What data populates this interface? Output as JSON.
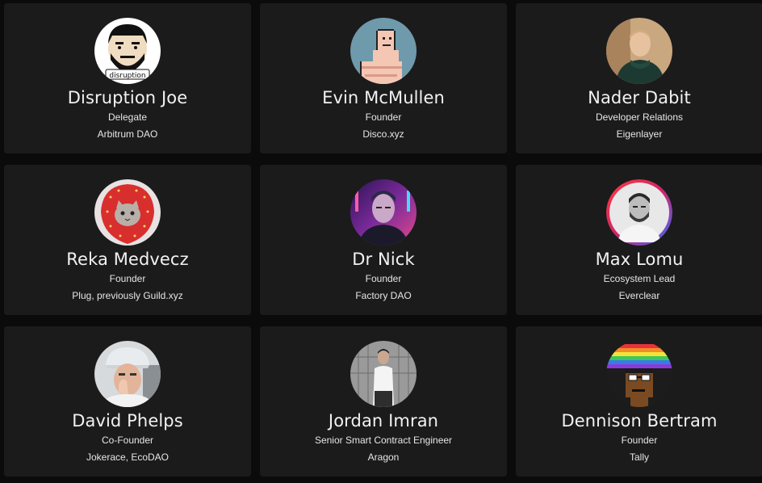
{
  "speakers": [
    {
      "name": "Disruption Joe",
      "role": "Delegate",
      "org": "Arbitrum DAO",
      "avatar_icon": "cartoon-man-avatar-icon"
    },
    {
      "name": "Evin McMullen",
      "role": "Founder",
      "org": "Disco.xyz",
      "avatar_icon": "pixel-character-avatar-icon"
    },
    {
      "name": "Nader Dabit",
      "role": "Developer Relations",
      "org": "Eigenlayer",
      "avatar_icon": "person-photo-avatar-icon"
    },
    {
      "name": "Reka Medvecz",
      "role": "Founder",
      "org": "Plug, previously Guild.xyz",
      "avatar_icon": "strawberry-cat-avatar-icon"
    },
    {
      "name": "Dr Nick",
      "role": "Founder",
      "org": "Factory DAO",
      "avatar_icon": "neon-portrait-avatar-icon"
    },
    {
      "name": "Max Lomu",
      "role": "Ecosystem Lead",
      "org": "Everclear",
      "avatar_icon": "bw-portrait-avatar-icon"
    },
    {
      "name": "David Phelps",
      "role": "Co-Founder",
      "org": "Jokerace, EcoDAO",
      "avatar_icon": "selfie-avatar-icon"
    },
    {
      "name": "Jordan Imran",
      "role": "Senior Smart Contract Engineer",
      "org": "Aragon",
      "avatar_icon": "standing-man-avatar-icon"
    },
    {
      "name": "Dennison Bertram",
      "role": "Founder",
      "org": "Tally",
      "avatar_icon": "rainbow-punk-avatar-icon"
    }
  ]
}
